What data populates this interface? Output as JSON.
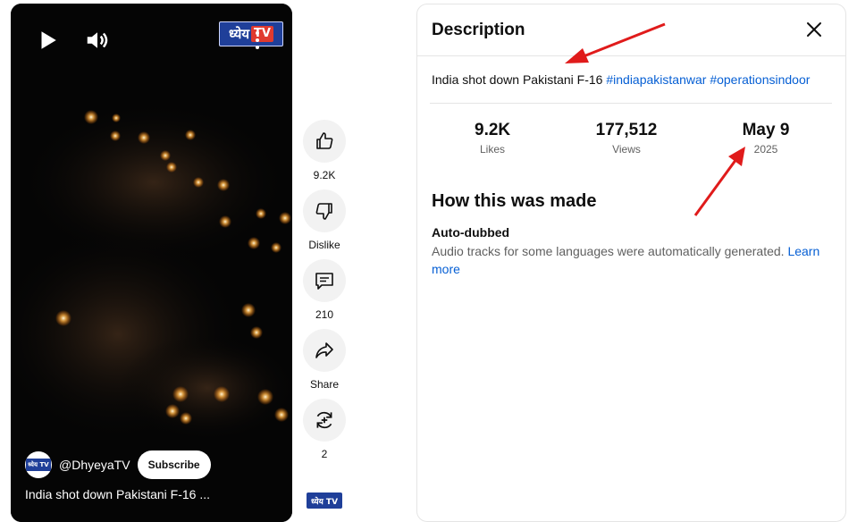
{
  "player": {
    "logo_text": "ध्येय",
    "logo_tv": "TV",
    "channel_handle": "@DhyeyaTV",
    "subscribe_label": "Subscribe",
    "title": "India shot down Pakistani F-16 ...",
    "avatar_text": "ध्येय TV"
  },
  "actions": {
    "like_count": "9.2K",
    "dislike_label": "Dislike",
    "comments_count": "210",
    "share_label": "Share",
    "remix_count": "2",
    "rail_logo": "ध्येय TV"
  },
  "description": {
    "heading": "Description",
    "text": "India shot down Pakistani F-16 ",
    "hashtags": [
      "#indiapakistanwar",
      "#operationsindoor"
    ],
    "stats": [
      {
        "value": "9.2K",
        "caption": "Likes"
      },
      {
        "value": "177,512",
        "caption": "Views"
      },
      {
        "value": "May 9",
        "caption": "2025"
      }
    ],
    "how_heading": "How this was made",
    "auto_title": "Auto-dubbed",
    "auto_text": "Audio tracks for some languages were automatically generated. ",
    "learn_more": "Learn more"
  },
  "colors": {
    "link": "#065fd4",
    "annotation_arrow": "#e01b1b",
    "logo_blue": "#1f3f99"
  }
}
